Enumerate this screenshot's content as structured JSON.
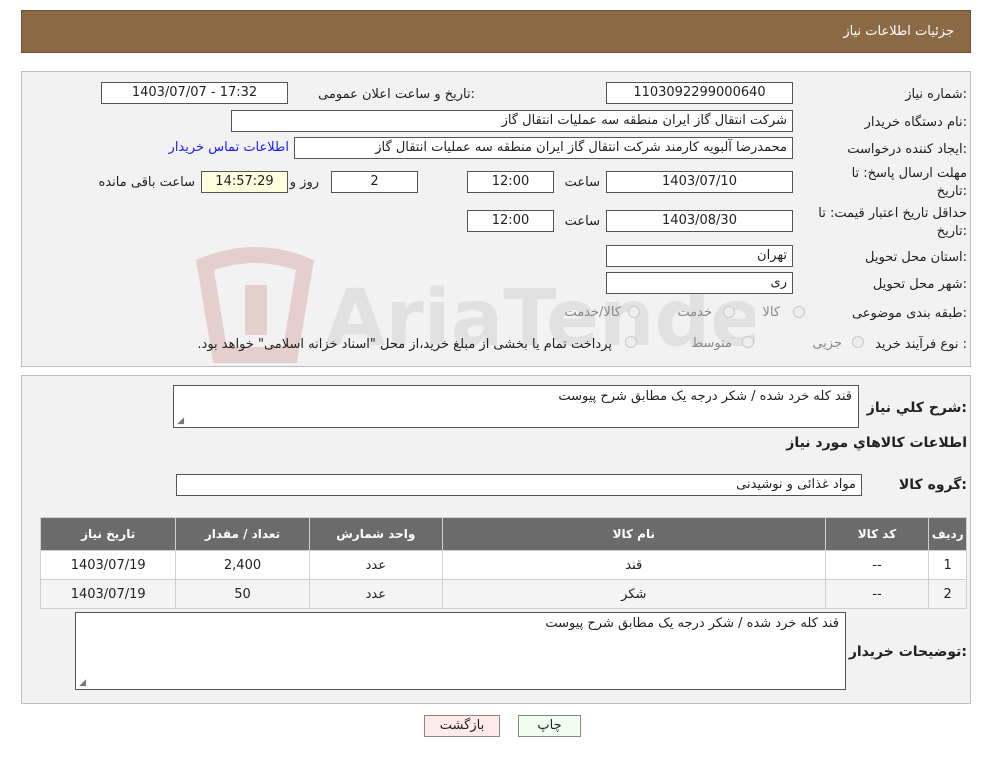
{
  "header": {
    "title": "جزئیات اطلاعات نیاز"
  },
  "form": {
    "need_number_label": "شماره نیاز:",
    "need_number": "1103092299000640",
    "announce_label": "تاریخ و ساعت اعلان عمومی:",
    "announce_value": "1403/07/07 - 17:32",
    "buyer_org_label": "نام دستگاه خريدار:",
    "buyer_org": "شرکت انتقال گاز ایران منطقه سه عملیات انتقال گاز",
    "creator_label": "ایجاد کننده درخواست:",
    "creator": "محمدرضا آلبویه کارمند شرکت انتقال گاز ایران منطقه سه عملیات انتقال گاز",
    "contact_link": "اطلاعات تماس خریدار",
    "deadline_label_1": "مهلت ارسال پاسخ: تا",
    "deadline_label_2": "تاریخ:",
    "deadline_date": "1403/07/10",
    "time_label": "ساعت",
    "deadline_time": "12:00",
    "days_value": "2",
    "days_label": "روز و",
    "remaining_time": "14:57:29",
    "remaining_label": "ساعت باقی مانده",
    "validity_label_1": "حداقل تاریخ اعتبار قیمت: تا",
    "validity_label_2": "تاریخ:",
    "validity_date": "1403/08/30",
    "validity_time": "12:00",
    "province_label": "استان محل تحویل:",
    "province": "تهران",
    "city_label": "شهر محل تحویل:",
    "city": "ری",
    "category_label": "طبقه بندی موضوعی:",
    "category_options": [
      "کالا",
      "خدمت",
      "کالا/خدمت"
    ],
    "purchase_type_label": "نوع فرآیند خرید :",
    "purchase_options": [
      "جزیی",
      "متوسط"
    ],
    "purchase_note": "پرداخت تمام یا بخشی از مبلغ خرید،از محل \"اسناد خزانه اسلامی\" خواهد بود."
  },
  "details": {
    "summary_label": "شرح کلي نياز:",
    "summary": "قند کله خرد شده  / شکر درجه یک مطابق شرح پیوست",
    "items_title": "اطلاعات کالاهاي مورد نياز",
    "group_label": "گروه کالا:",
    "group": "مواد غذائی و نوشیدنی",
    "columns": [
      "رديف",
      "کد کالا",
      "نام کالا",
      "واحد شمارش",
      "تعداد / مقدار",
      "تاريخ نياز"
    ],
    "rows": [
      [
        "1",
        "--",
        "قند",
        "عدد",
        "2,400",
        "1403/07/19"
      ],
      [
        "2",
        "--",
        "شکر",
        "عدد",
        "50",
        "1403/07/19"
      ]
    ],
    "buyer_notes_label": "توضیحات خریدار:",
    "buyer_notes": "قند کله خرد شده  / شکر درجه یک مطابق شرح پیوست"
  },
  "buttons": {
    "print": "چاپ",
    "back": "بازگشت"
  },
  "watermark_text": "AriaTender.neT"
}
